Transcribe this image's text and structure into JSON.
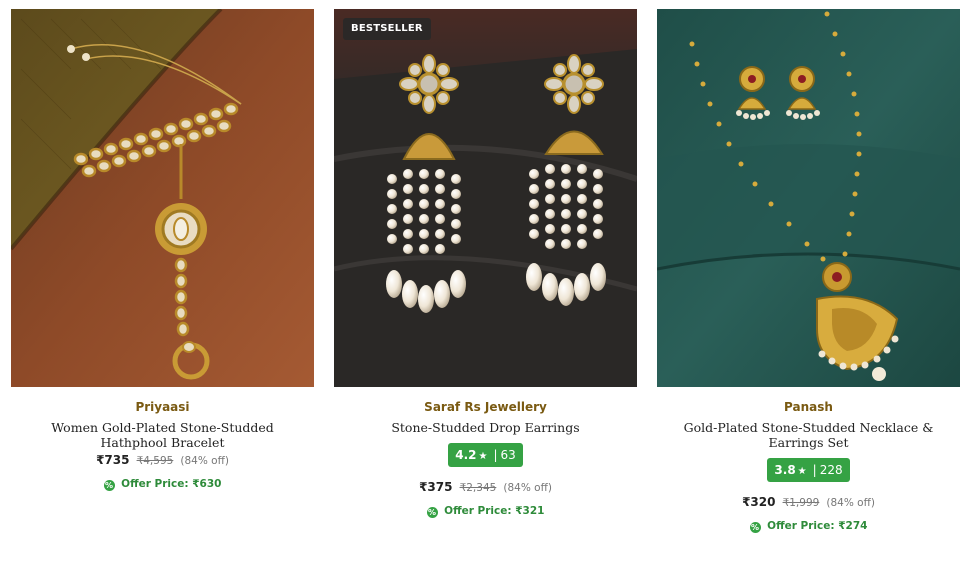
{
  "products": [
    {
      "brand": "Priyaasi",
      "name": "Women Gold-Plated Stone-Studded Hathphool Bracelet",
      "price": "₹735",
      "mrp": "₹4,595",
      "discount": "(84% off)",
      "offer_label": "Offer Price:",
      "offer_price": "₹630",
      "image_icon": "hathphool-bracelet-image"
    },
    {
      "badge": "BESTSELLER",
      "brand": "Saraf Rs Jewellery",
      "name": "Stone-Studded Drop Earrings",
      "rating": "4.2",
      "rating_star": "★",
      "rating_sep": "|",
      "rating_count": "63",
      "price": "₹375",
      "mrp": "₹2,345",
      "discount": "(84% off)",
      "offer_label": "Offer Price:",
      "offer_price": "₹321",
      "image_icon": "drop-earrings-image"
    },
    {
      "brand": "Panash",
      "name": "Gold-Plated Stone-Studded Necklace & Earrings Set",
      "rating": "3.8",
      "rating_star": "★",
      "rating_sep": "|",
      "rating_count": "228",
      "price": "₹320",
      "mrp": "₹1,999",
      "discount": "(84% off)",
      "offer_label": "Offer Price:",
      "offer_price": "₹274",
      "image_icon": "necklace-earrings-set-image"
    }
  ],
  "offer_icon_glyph": "%",
  "colors": {
    "brand_text": "#7a5a12",
    "rating_bg": "#35a244",
    "offer_text": "#2e8b3a",
    "badge_bg": "#282828"
  }
}
